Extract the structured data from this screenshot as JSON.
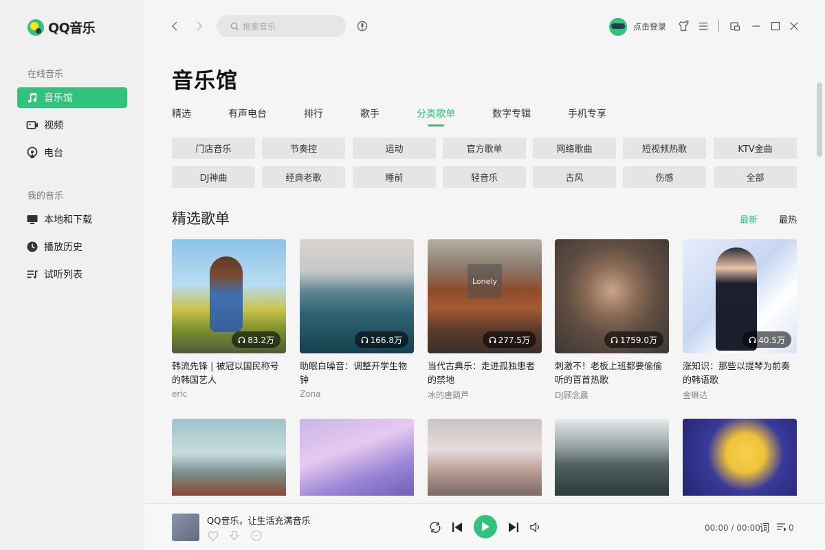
{
  "app": {
    "name": "QQ音乐"
  },
  "sidebar": {
    "online_heading": "在线音乐",
    "online_items": [
      {
        "label": "音乐馆",
        "icon": "music-note-icon",
        "active": true
      },
      {
        "label": "视频",
        "icon": "video-icon",
        "active": false
      },
      {
        "label": "电台",
        "icon": "radio-icon",
        "active": false
      }
    ],
    "mine_heading": "我的音乐",
    "mine_items": [
      {
        "label": "本地和下载",
        "icon": "monitor-icon"
      },
      {
        "label": "播放历史",
        "icon": "clock-icon"
      },
      {
        "label": "试听列表",
        "icon": "playlist-icon"
      }
    ]
  },
  "topbar": {
    "search_placeholder": "搜索音乐",
    "login_label": "点击登录"
  },
  "main": {
    "title": "音乐馆",
    "tabs": [
      {
        "label": "精选",
        "active": false
      },
      {
        "label": "有声电台",
        "active": false
      },
      {
        "label": "排行",
        "active": false
      },
      {
        "label": "歌手",
        "active": false
      },
      {
        "label": "分类歌单",
        "active": true
      },
      {
        "label": "数字专辑",
        "active": false
      },
      {
        "label": "手机专享",
        "active": false
      }
    ],
    "categories": [
      [
        "门店音乐",
        "节奏控",
        "运动",
        "官方歌单",
        "网络歌曲",
        "短视频热歌",
        "KTV金曲"
      ],
      [
        "DJ神曲",
        "经典老歌",
        "睡前",
        "轻音乐",
        "古风",
        "伤感",
        "全部"
      ]
    ],
    "section_title": "精选歌单",
    "sort_options": [
      {
        "label": "最新",
        "active": true
      },
      {
        "label": "最热",
        "active": false
      }
    ],
    "playlists": [
      {
        "title": "韩流先锋 | 被冠以国民称号的韩国艺人",
        "author": "eric",
        "plays": "83.2万"
      },
      {
        "title": "助眠白噪音：调整开学生物钟",
        "author": "Zona",
        "plays": "166.8万"
      },
      {
        "title": "当代古典乐：走进孤独患者的禁地",
        "author": "冰的唐葫芦",
        "plays": "277.5万",
        "cover_text": "Lonely"
      },
      {
        "title": "刺激不！老板上班都要偷偷听的百首热歌",
        "author": "DJ顾念晨",
        "plays": "1759.0万"
      },
      {
        "title": "涨知识：那些以提琴为前奏的韩语歌",
        "author": "金琳达",
        "plays": "40.5万"
      }
    ]
  },
  "player": {
    "title": "QQ音乐，让生活充满音乐",
    "time": "00:00 / 00:00",
    "lyrics_label": "词",
    "queue_count": "0"
  },
  "colors": {
    "accent": "#31c27c"
  }
}
